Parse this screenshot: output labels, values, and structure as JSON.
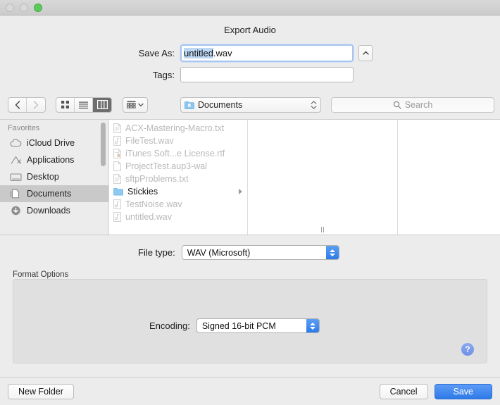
{
  "window": {
    "traffic_lights": [
      {
        "name": "close",
        "state": "disabled"
      },
      {
        "name": "minimize",
        "state": "disabled"
      },
      {
        "name": "zoom",
        "state": "enabled",
        "color": "#5cc95c"
      }
    ]
  },
  "sheet": {
    "title": "Export Audio",
    "save_as_label": "Save As:",
    "save_as_selected": "untitled",
    "save_as_rest": ".wav",
    "save_as_full": "untitled.wav",
    "expand_icon": "chevron-up-icon",
    "tags_label": "Tags:",
    "tags_value": "",
    "tags_placeholder": ""
  },
  "toolbar": {
    "back_icon": "chevron-left-icon",
    "forward_icon": "chevron-right-icon",
    "view_modes": [
      {
        "name": "icon-view",
        "icon": "grid-icon",
        "selected": false
      },
      {
        "name": "list-view",
        "icon": "list-icon",
        "selected": false
      },
      {
        "name": "column-view",
        "icon": "columns-icon",
        "selected": true
      }
    ],
    "arrange_icon": "arrange-grid-icon",
    "path_label": "Documents",
    "path_icon": "folder-blue-icon",
    "search_placeholder": "Search",
    "search_icon": "search-icon",
    "search_value": ""
  },
  "sidebar": {
    "header": "Favorites",
    "items": [
      {
        "label": "iCloud Drive",
        "icon": "cloud-icon",
        "selected": false
      },
      {
        "label": "Applications",
        "icon": "applications-icon",
        "selected": false
      },
      {
        "label": "Desktop",
        "icon": "desktop-icon",
        "selected": false
      },
      {
        "label": "Documents",
        "icon": "documents-icon",
        "selected": true
      },
      {
        "label": "Downloads",
        "icon": "downloads-icon",
        "selected": false
      }
    ]
  },
  "file_list": [
    {
      "name": "ACX-Mastering-Macro.txt",
      "icon": "text-document-icon",
      "type": "file",
      "dimmed": true
    },
    {
      "name": "FileTest.wav",
      "icon": "audio-file-icon",
      "type": "file",
      "dimmed": true
    },
    {
      "name": "iTunes Soft...e License.rtf",
      "icon": "rtf-document-icon",
      "type": "file",
      "dimmed": true
    },
    {
      "name": "ProjectTest.aup3-wal",
      "icon": "blank-document-icon",
      "type": "file",
      "dimmed": true
    },
    {
      "name": "sftpProblems.txt",
      "icon": "text-document-icon",
      "type": "file",
      "dimmed": true
    },
    {
      "name": "Stickies",
      "icon": "folder-blue-icon",
      "type": "folder",
      "dimmed": false
    },
    {
      "name": "TestNoise.wav",
      "icon": "audio-file-icon",
      "type": "file",
      "dimmed": true
    },
    {
      "name": "untitled.wav",
      "icon": "audio-file-icon",
      "type": "file",
      "dimmed": true
    }
  ],
  "options": {
    "file_type_label": "File type:",
    "file_type_value": "WAV (Microsoft)",
    "format_options_label": "Format Options",
    "encoding_label": "Encoding:",
    "encoding_value": "Signed 16-bit PCM",
    "help_label": "?"
  },
  "footer": {
    "new_folder_label": "New Folder",
    "cancel_label": "Cancel",
    "save_label": "Save",
    "accent_color": "#2f7ae8"
  }
}
